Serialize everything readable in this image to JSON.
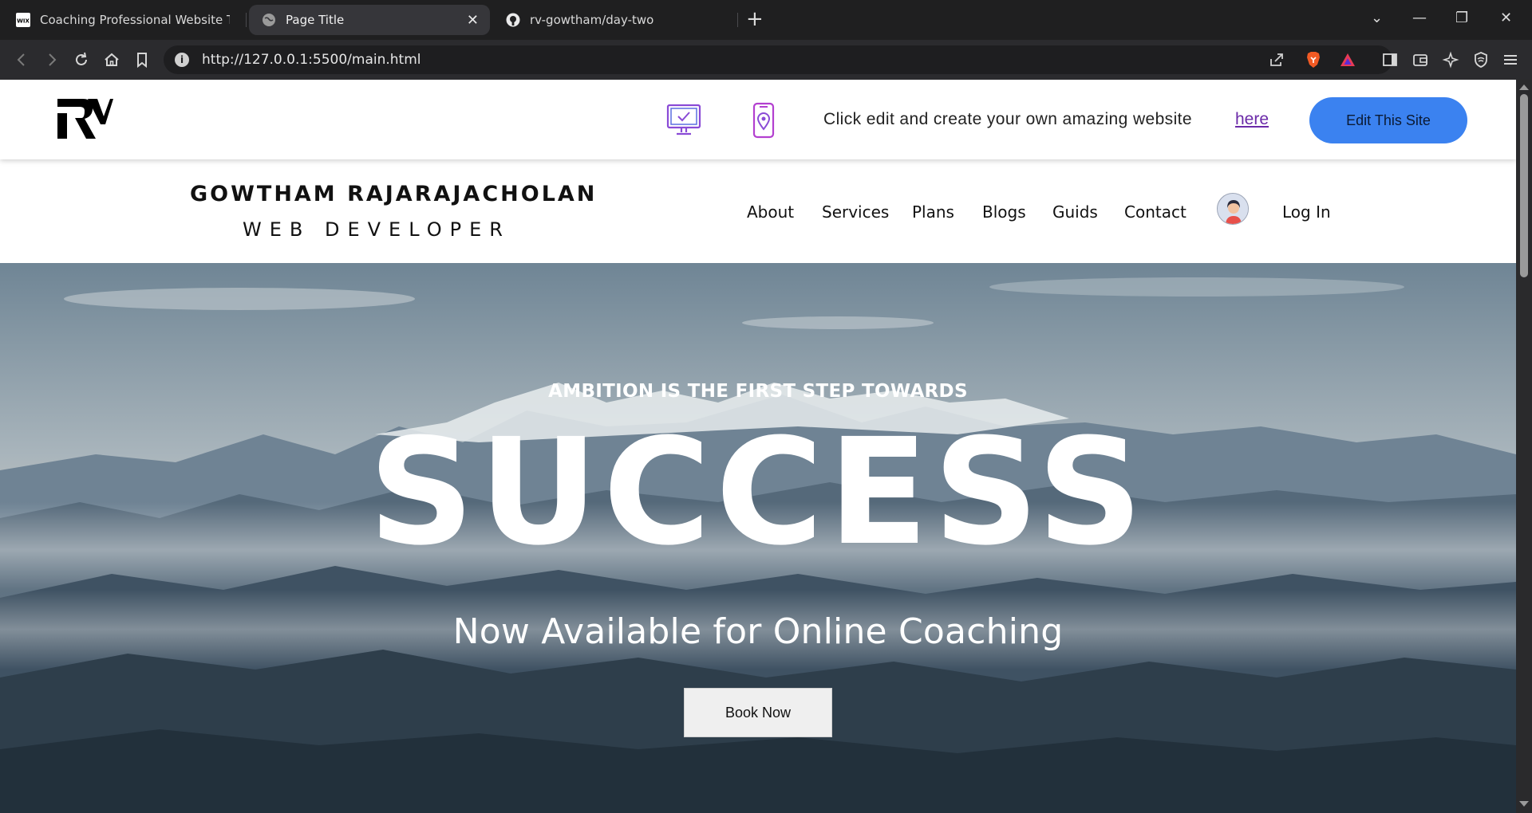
{
  "tabs": [
    {
      "title": "Coaching Professional Website Templ",
      "icon": "wix-favicon"
    },
    {
      "title": "Page Title",
      "icon": "globe-icon",
      "active": true
    },
    {
      "title": "rv-gowtham/day-two",
      "icon": "github-icon"
    }
  ],
  "address_bar": {
    "url": "http://127.0.0.1:5500/main.html"
  },
  "promo_bar": {
    "text": "Click edit and create your own amazing website",
    "link": "here",
    "button": "Edit This Site"
  },
  "header": {
    "brand_name": "GOWTHAM RAJARAJACHOLAN",
    "brand_role": "WEB DEVELOPER",
    "nav": [
      "About",
      "Services",
      "Plans",
      "Blogs",
      "Guids",
      "Contact"
    ],
    "login": "Log In"
  },
  "hero": {
    "subtitle": "AMBITION IS THE FIRST STEP TOWARDS",
    "headline": "SUCCESS",
    "tagline": "Now Available for Online Coaching",
    "button": "Book Now"
  },
  "colors": {
    "accent_button": "#3b82f0",
    "link": "#6b2aa8",
    "promo_icon": "#8a4bd6"
  }
}
